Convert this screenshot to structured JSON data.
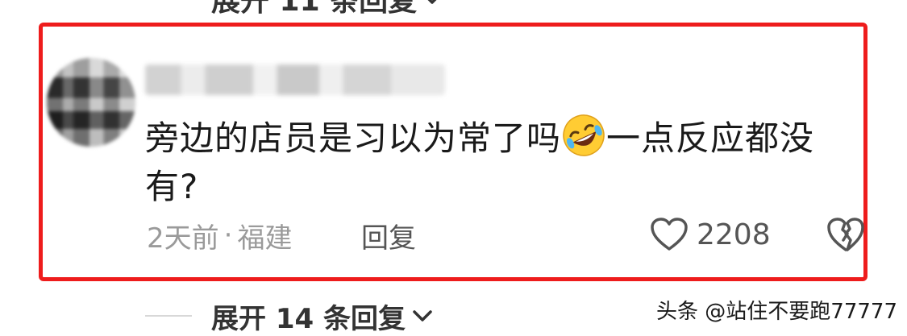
{
  "top_expand": {
    "label": "展开 11 条回复"
  },
  "comment": {
    "text_before_emoji": "旁边的店员是习以为常了吗",
    "emoji_name": "rolling-on-floor-laughing-emoji",
    "text_after_emoji": "一点反应都没有?",
    "time": "2天前",
    "separator": "·",
    "location": "福建",
    "reply_label": "回复",
    "like_count": "2208"
  },
  "bottom_expand": {
    "label": "展开 14 条回复"
  },
  "watermark": {
    "text": "头条 @站住不要跑77777"
  },
  "colors": {
    "highlight_border": "#ee1c1c",
    "muted_text": "#9a9a9a"
  }
}
